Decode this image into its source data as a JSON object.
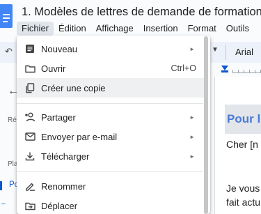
{
  "header": {
    "title": "1. Modèles de lettres de demande de formation à",
    "menus": [
      {
        "label": "Fichier",
        "active": true
      },
      {
        "label": "Édition"
      },
      {
        "label": "Affichage"
      },
      {
        "label": "Insertion"
      },
      {
        "label": "Format"
      },
      {
        "label": "Outils"
      }
    ]
  },
  "toolbar": {
    "undo_glyph": "↶",
    "dropdown_glyph": "▼",
    "font": "Arial"
  },
  "outline": {
    "back_glyph": "←",
    "label_re": "Ré",
    "label_pl": "Pla",
    "item_po": "Po",
    "dash": "–"
  },
  "document": {
    "heading": "Pour l",
    "line1": "Cher [n",
    "line2": "Je vous",
    "line3": "fait actu"
  },
  "file_menu": {
    "items": [
      {
        "label": "Nouveau",
        "icon": "document-icon",
        "submenu": true
      },
      {
        "label": "Ouvrir",
        "icon": "folder-icon",
        "shortcut": "Ctrl+O"
      },
      {
        "label": "Créer une copie",
        "icon": "copy-icon"
      },
      {
        "label": "Partager",
        "icon": "person-add-icon",
        "submenu": true
      },
      {
        "label": "Envoyer par e-mail",
        "icon": "mail-icon",
        "submenu": true
      },
      {
        "label": "Télécharger",
        "icon": "download-icon",
        "submenu": true
      },
      {
        "label": "Renommer",
        "icon": "rename-icon"
      },
      {
        "label": "Déplacer",
        "icon": "move-folder-icon"
      }
    ],
    "submenu_glyph": "►"
  },
  "colors": {
    "accent": "#0b57d0",
    "doc_icon": "#4285f4",
    "menu_hover": "#eef0f2",
    "heading_text": "#4a7ad8"
  }
}
